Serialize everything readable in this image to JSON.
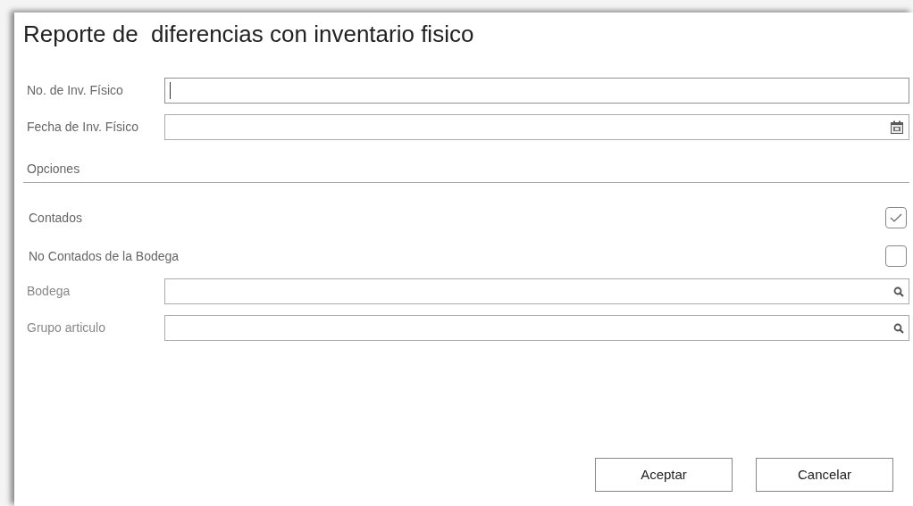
{
  "window": {
    "title": "Reporte de  diferencias con inventario fisico"
  },
  "fields": [
    {
      "label": "No. de Inv. Físico",
      "kind": "text",
      "focused": true
    },
    {
      "label": "Fecha de Inv. Físico",
      "kind": "date",
      "focused": false
    }
  ],
  "options_section": {
    "title": "Opciones",
    "checkboxes": [
      {
        "label": "Contados",
        "checked": true
      },
      {
        "label": "No Contados de la Bodega",
        "checked": false
      }
    ],
    "fields": [
      {
        "label": "Bodega",
        "kind": "lookup",
        "focused": false
      },
      {
        "label": "Grupo articulo",
        "kind": "lookup",
        "focused": false
      }
    ]
  },
  "buttons": [
    "Aceptar",
    "Cancelar"
  ]
}
